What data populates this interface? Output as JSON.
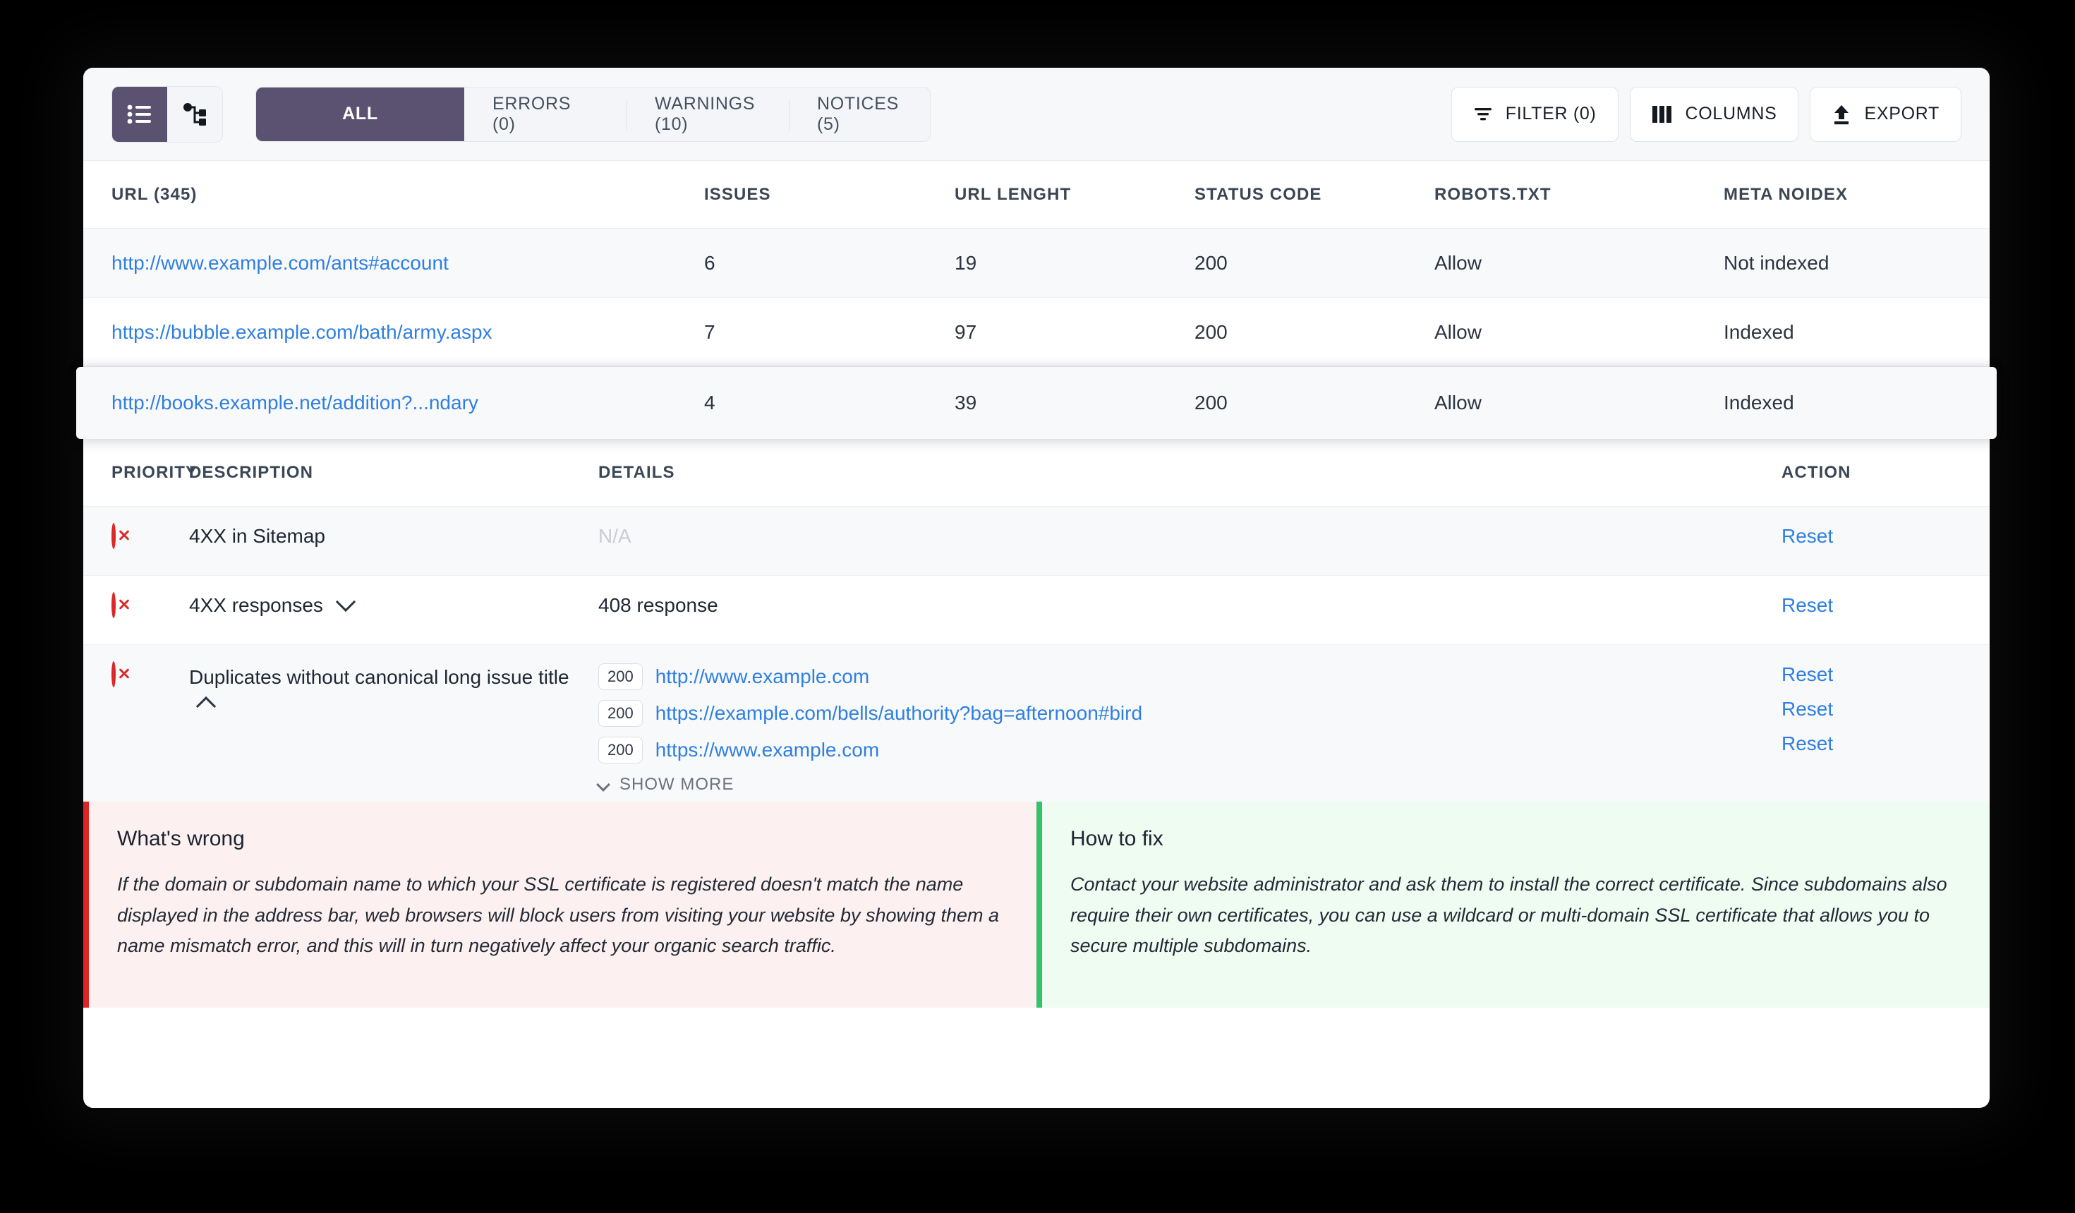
{
  "toolbar": {
    "view_toggle": [
      {
        "name": "list-view",
        "icon": "list-icon",
        "active": true
      },
      {
        "name": "tree-view",
        "icon": "sitemap-icon",
        "active": false
      }
    ],
    "tabs": [
      {
        "label": "ALL",
        "active": true
      },
      {
        "label": "ERRORS (0)",
        "active": false
      },
      {
        "label": "WARNINGS (10)",
        "active": false
      },
      {
        "label": "NOTICES (5)",
        "active": false
      }
    ],
    "actions": [
      {
        "label": "FILTER (0)",
        "icon": "filter-icon"
      },
      {
        "label": "COLUMNS",
        "icon": "columns-icon"
      },
      {
        "label": "EXPORT",
        "icon": "export-icon"
      }
    ]
  },
  "table": {
    "headers": {
      "url": "URL (345)",
      "issues": "ISSUES",
      "length": "URL LENGHT",
      "status": "STATUS CODE",
      "robots": "ROBOTS.TXT",
      "noidex": "META NOIDEX"
    },
    "rows": [
      {
        "url": "http://www.example.com/ants#account",
        "issues": "6",
        "length": "19",
        "status": "200",
        "robots": "Allow",
        "noidex": "Not indexed"
      },
      {
        "url": "https://bubble.example.com/bath/army.aspx",
        "issues": "7",
        "length": "97",
        "status": "200",
        "robots": "Allow",
        "noidex": "Indexed"
      },
      {
        "url": "http://books.example.net/addition?...ndary",
        "issues": "4",
        "length": "39",
        "status": "200",
        "robots": "Allow",
        "noidex": "Indexed"
      }
    ]
  },
  "details": {
    "headers": {
      "priority": "PRIORITY",
      "description": "DESCRIPTION",
      "details": "DETAILS",
      "action": "ACTION"
    },
    "rows": [
      {
        "priority_icon": "error-circle-icon",
        "description": "4XX in Sitemap",
        "expandable": false,
        "details_text": "N/A",
        "details_muted": true,
        "action": "Reset"
      },
      {
        "priority_icon": "error-circle-icon",
        "description": "4XX responses",
        "expandable": true,
        "expanded": false,
        "details_text": "408 response",
        "details_muted": false,
        "action": "Reset"
      },
      {
        "priority_icon": "error-circle-icon",
        "description": "Duplicates without canonical long issue title",
        "expandable": true,
        "expanded": true,
        "links": [
          {
            "code": "200",
            "url": "http://www.example.com",
            "action": "Reset"
          },
          {
            "code": "200",
            "url": "https://example.com/bells/authority?bag=afternoon#bird",
            "action": "Reset"
          },
          {
            "code": "200",
            "url": "https://www.example.com",
            "action": "Reset"
          }
        ],
        "show_more": "SHOW MORE"
      }
    ]
  },
  "panels": {
    "wrong": {
      "title": "What's wrong",
      "body": "If the domain or subdomain name to which your SSL certificate is registered doesn't match the name displayed in the address bar, web browsers will block users from visiting your website by showing them a name mismatch error, and this will in turn negatively affect your organic search traffic.",
      "accent": "#e02424"
    },
    "fix": {
      "title": "How to fix",
      "body": "Contact your website administrator and ask them to install the correct certificate. Since subdomains also require their own certificates, you can use a wildcard or multi-domain SSL certificate that allows you to secure multiple subdomains.",
      "accent": "#34c36b"
    }
  },
  "colors": {
    "brand_purple": "#5b5272",
    "link_blue": "#2f7fe0",
    "error_red": "#dc2828"
  }
}
